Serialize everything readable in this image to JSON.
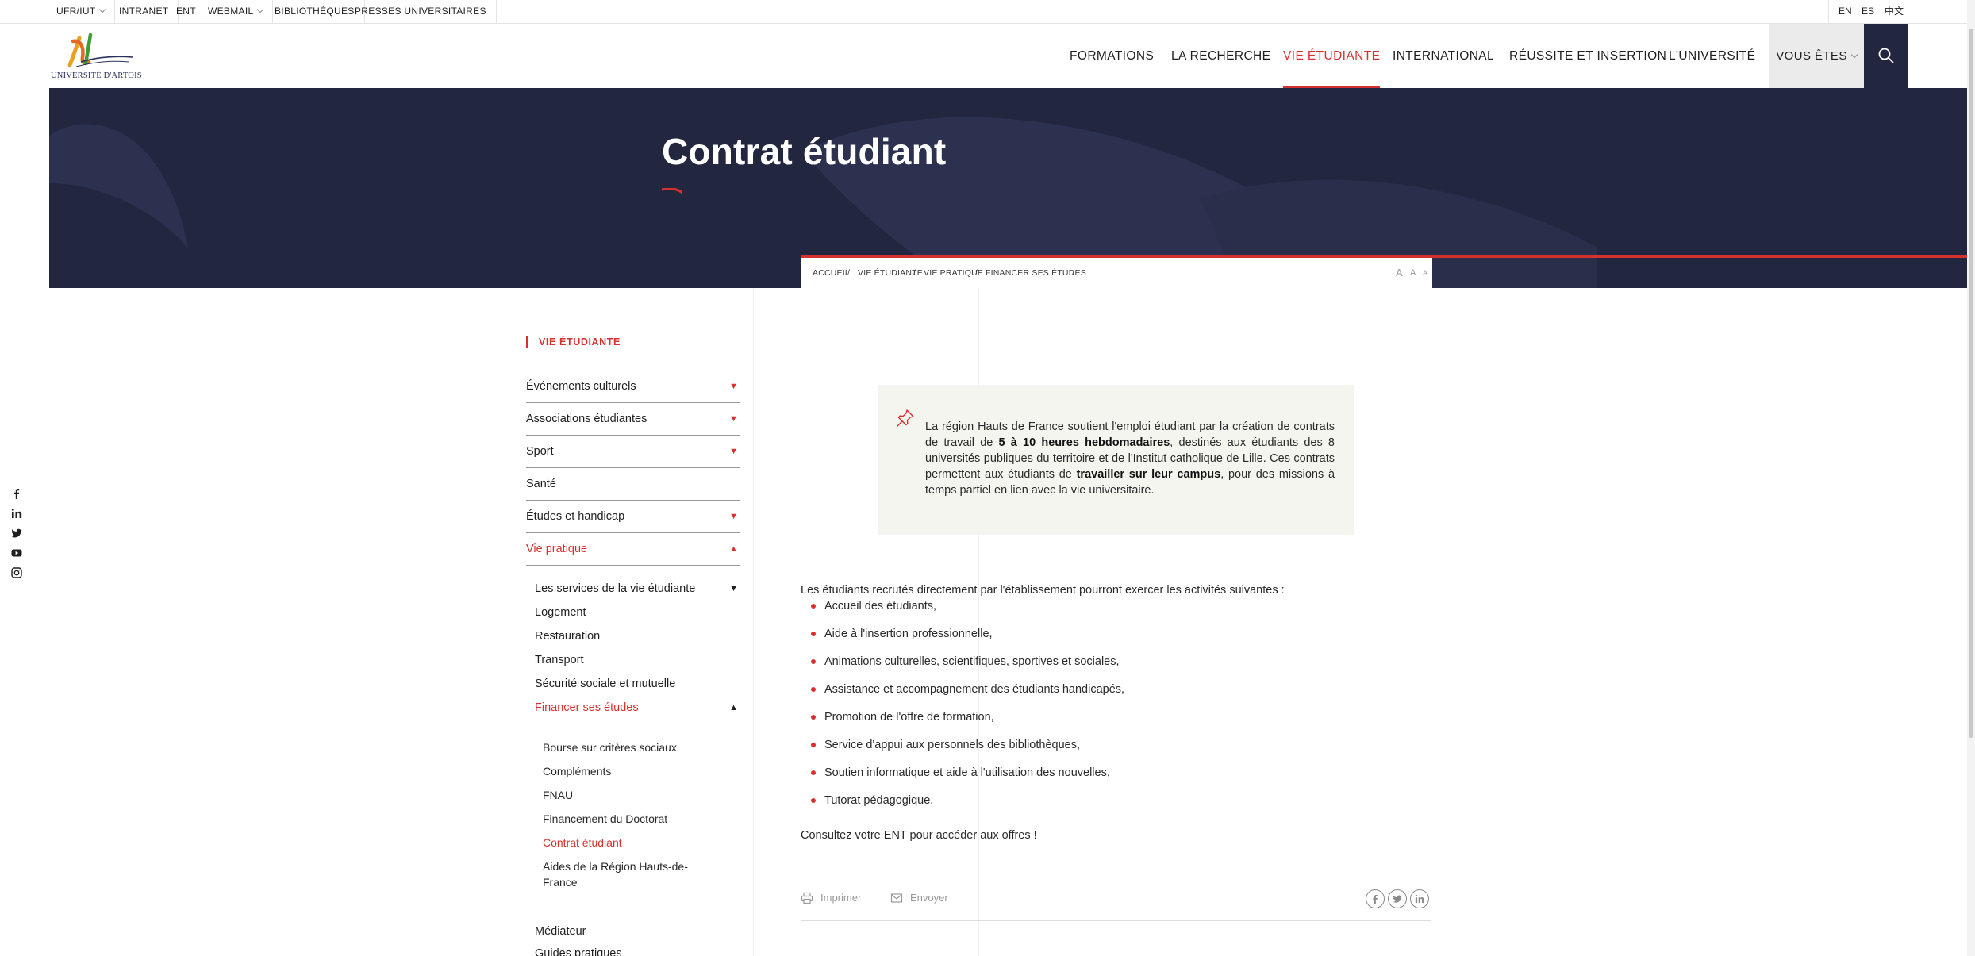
{
  "topbar": {
    "links": [
      {
        "label": "UFR/IUT",
        "dropdown": true
      },
      {
        "label": "INTRANET",
        "dropdown": false
      },
      {
        "label": "ENT",
        "dropdown": false
      },
      {
        "label": "WEBMAIL",
        "dropdown": true
      },
      {
        "label": "BIBLIOTHÈQUES",
        "dropdown": false
      },
      {
        "label": "PRESSES UNIVERSITAIRES",
        "dropdown": false
      }
    ],
    "languages": [
      "EN",
      "ES",
      "中文"
    ]
  },
  "header": {
    "logo_text": "UNIVERSITÉ D'ARTOIS",
    "nav": [
      {
        "label": "FORMATIONS",
        "active": false
      },
      {
        "label": "LA RECHERCHE",
        "active": false
      },
      {
        "label": "VIE ÉTUDIANTE",
        "active": true
      },
      {
        "label": "INTERNATIONAL",
        "active": false
      },
      {
        "label": "RÉUSSITE ET INSERTION",
        "active": false
      },
      {
        "label": "L'UNIVERSITÉ",
        "active": false
      }
    ],
    "vous_etes": "VOUS ÊTES",
    "search_icon": "search-icon"
  },
  "hero": {
    "title": "Contrat étudiant"
  },
  "breadcrumb": {
    "items": [
      "ACCUEIL",
      "VIE ÉTUDIANTE",
      "VIE PRATIQUE",
      "FINANCER SES ÉTUDES"
    ],
    "separator": "/",
    "font_size_controls": [
      "A",
      "A",
      "A"
    ]
  },
  "social": [
    "facebook-icon",
    "linkedin-icon",
    "twitter-icon",
    "youtube-icon",
    "instagram-icon"
  ],
  "sidebar": {
    "title": "VIE ÉTUDIANTE",
    "items": [
      {
        "label": "Événements culturels",
        "toggle": "▼",
        "active": false
      },
      {
        "label": "Associations étudiantes",
        "toggle": "▼",
        "active": false
      },
      {
        "label": "Sport",
        "toggle": "▼",
        "active": false
      },
      {
        "label": "Santé",
        "toggle": "",
        "active": false
      },
      {
        "label": "Études et handicap",
        "toggle": "▼",
        "active": false
      },
      {
        "label": "Vie pratique",
        "toggle": "▲",
        "active": true
      }
    ],
    "subitems": [
      {
        "label": "Les services de la vie étudiante",
        "toggle": "▼",
        "active": false
      },
      {
        "label": "Logement",
        "toggle": "",
        "active": false
      },
      {
        "label": "Restauration",
        "toggle": "",
        "active": false
      },
      {
        "label": "Transport",
        "toggle": "",
        "active": false
      },
      {
        "label": "Sécurité sociale et mutuelle",
        "toggle": "",
        "active": false
      },
      {
        "label": "Financer ses études",
        "toggle": "▲",
        "active": true
      }
    ],
    "subsubitems": [
      {
        "label": "Bourse sur critères sociaux",
        "active": false
      },
      {
        "label": "Compléments",
        "active": false
      },
      {
        "label": "FNAU",
        "active": false
      },
      {
        "label": "Financement du Doctorat",
        "active": false
      },
      {
        "label": "Contrat étudiant",
        "active": true
      },
      {
        "label": "Aides de la Région Hauts-de-France",
        "active": false
      }
    ],
    "after": [
      "Médiateur",
      "Guides pratiques"
    ]
  },
  "note": {
    "icon": "pin-icon",
    "text_1": "La région Hauts de France soutient l'emploi étudiant par la création de contrats de travail de ",
    "bold_1": "5 à 10 heures hebdomadaires",
    "text_2": ", destinés aux étudiants des 8 universités publiques du territoire et de l'Institut catholique de Lille. Ces contrats permettent aux étudiants de ",
    "bold_2": "travailler sur leur campus",
    "text_3": ", pour des missions à temps partiel en lien avec la vie universitaire."
  },
  "content": {
    "intro": "Les étudiants recrutés directement par l'établissement pourront exercer les activités suivantes :",
    "activities": [
      "Accueil des étudiants,",
      "Aide à l'insertion professionnelle,",
      "Animations culturelles, scientifiques, sportives et sociales,",
      "Assistance et accompagnement des étudiants handicapés,",
      "Promotion de l'offre de formation,",
      "Service d'appui aux personnels des bibliothèques,",
      "Soutien informatique et aide à l'utilisation des nouvelles,",
      "Tutorat pédagogique."
    ],
    "outro": "Consultez votre ENT pour accéder aux offres !"
  },
  "actions": {
    "print": "Imprimer",
    "send": "Envoyer",
    "share": [
      "facebook-icon",
      "twitter-icon",
      "linkedin-icon"
    ]
  },
  "colors": {
    "accent": "#d6312f",
    "navy": "#23263f",
    "note_bg": "#f5f5f0"
  }
}
